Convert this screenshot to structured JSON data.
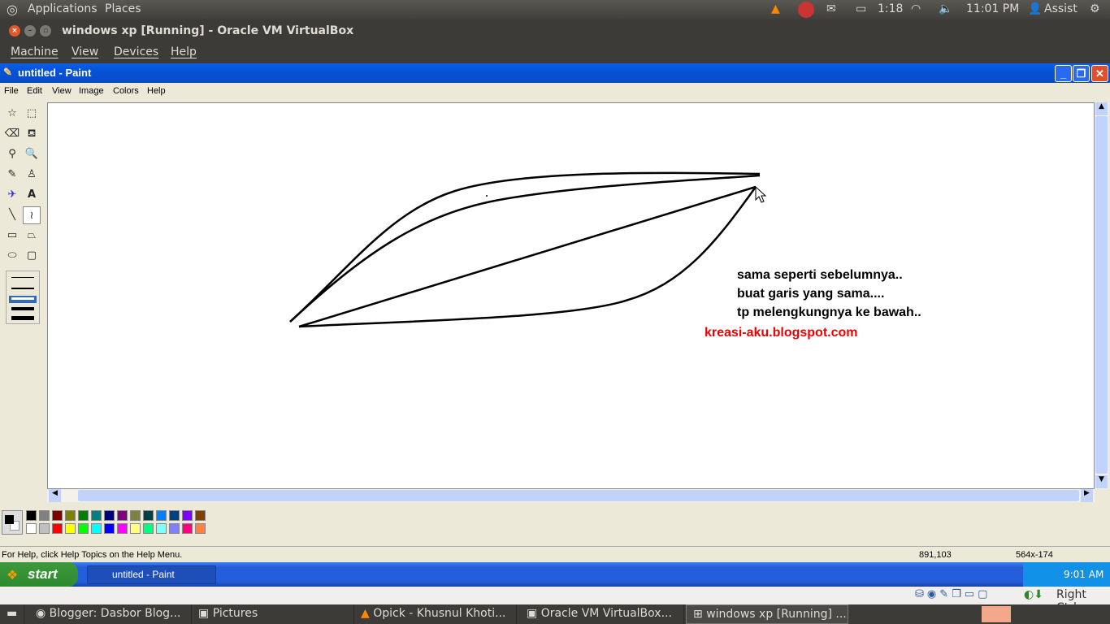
{
  "top_panel": {
    "applications": "Applications",
    "places": "Places",
    "battery_time": "1:18",
    "clock": "11:01 PM",
    "user": "Assist"
  },
  "vbox": {
    "title": "windows xp [Running] - Oracle VM VirtualBox",
    "menu": [
      "Machine",
      "View",
      "Devices",
      "Help"
    ],
    "host_key": "Right Ctrl"
  },
  "paint": {
    "title": "untitled - Paint",
    "menu": [
      "File",
      "Edit",
      "View",
      "Image",
      "Colors",
      "Help"
    ],
    "notes": [
      "sama seperti sebelumnya..",
      "buat garis yang sama....",
      "tp melengkungnya ke bawah.."
    ],
    "watermark": "kreasi-aku.blogspot.com",
    "status_help": "For Help, click Help Topics on the Help Menu.",
    "cursor_pos": "891,103",
    "selection_size": "564x-174",
    "palette_top": [
      "#000000",
      "#808080",
      "#800000",
      "#808000",
      "#008000",
      "#008080",
      "#000080",
      "#800080",
      "#808040",
      "#004040",
      "#0080ff",
      "#004080",
      "#8000ff",
      "#804000"
    ],
    "palette_bottom": [
      "#ffffff",
      "#c0c0c0",
      "#ff0000",
      "#ffff00",
      "#00ff00",
      "#00ffff",
      "#0000ff",
      "#ff00ff",
      "#ffff80",
      "#00ff80",
      "#80ffff",
      "#8080ff",
      "#ff0080",
      "#ff8040"
    ]
  },
  "xp_taskbar": {
    "start": "start",
    "task": "untitled - Paint",
    "clock": "9:01 AM"
  },
  "bottom_panel": {
    "tasks": [
      "Blogger: Dasbor Blog...",
      "Pictures",
      "Opick - Khusnul Khoti...",
      "Oracle VM VirtualBox...",
      "windows xp [Running] ..."
    ]
  }
}
